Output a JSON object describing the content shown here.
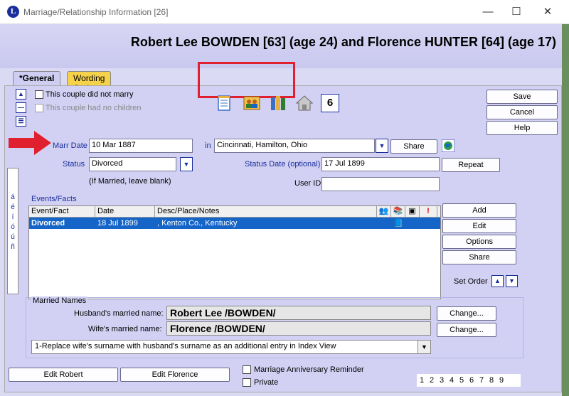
{
  "window": {
    "title": "Marriage/Relationship Information [26]",
    "app_icon": "L",
    "minimize": "—",
    "maximize": "☐",
    "close": "✕"
  },
  "header": {
    "title": "Robert Lee BOWDEN [63] (age 24) and Florence HUNTER [64] (age 17)"
  },
  "tabs": [
    {
      "label": "*General",
      "active": true
    },
    {
      "label": "Wording Options",
      "active": false
    }
  ],
  "left_controls": {
    "up_icon": "arrow-up-icon",
    "minus_icon": "minus-icon",
    "list_icon": "list-icon"
  },
  "checkboxes": {
    "did_not_marry": "This couple did not marry",
    "no_children": "This couple had no children"
  },
  "toolbar_icons": [
    "notepad-icon",
    "people-icon",
    "books-icon",
    "home-icon",
    "calendar-icon"
  ],
  "calendar_day": "6",
  "buttons": {
    "save": "Save",
    "cancel": "Cancel",
    "help": "Help",
    "share_place": "Share",
    "repeat": "Repeat",
    "add": "Add",
    "edit": "Edit",
    "options": "Options",
    "share": "Share",
    "change_husband": "Change...",
    "change_wife": "Change...",
    "edit_robert": "Edit Robert",
    "edit_florence": "Edit Florence"
  },
  "marr_date": {
    "label": "Marr Date",
    "value": "10 Mar 1887"
  },
  "place": {
    "label": "in",
    "value": "Cincinnati, Hamilton, Ohio"
  },
  "status": {
    "label": "Status",
    "value": "Divorced",
    "hint": "(If Married, leave blank)"
  },
  "status_date": {
    "label": "Status Date (optional)",
    "value": "17 Jul 1899"
  },
  "user_id": {
    "label": "User ID",
    "value": ""
  },
  "lang_chars": [
    "á",
    "é",
    "í",
    "ó",
    "ú",
    "ñ"
  ],
  "events": {
    "label": "Events/Facts",
    "columns": [
      "Event/Fact",
      "Date",
      "Desc/Place/Notes"
    ],
    "rows": [
      {
        "event": "Divorced",
        "date": "18 Jul 1899",
        "desc": ", Kenton Co., Kentucky"
      }
    ]
  },
  "set_order": "Set Order",
  "married_names": {
    "label": "Married Names",
    "husband_label": "Husband's married name:",
    "husband_value": "Robert Lee /BOWDEN/",
    "wife_label": "Wife's married name:",
    "wife_value": "Florence /BOWDEN/",
    "option": "1-Replace wife's surname with husband's surname as an additional entry in Index View"
  },
  "bottom": {
    "anniversary": "Marriage Anniversary Reminder",
    "private": "Private",
    "pages": [
      "1",
      "2",
      "3",
      "4",
      "5",
      "6",
      "7",
      "8",
      "9"
    ]
  },
  "colors": {
    "highlight": "#e0202e",
    "selected_row": "#1565c8",
    "arrow": "#e0202e"
  }
}
